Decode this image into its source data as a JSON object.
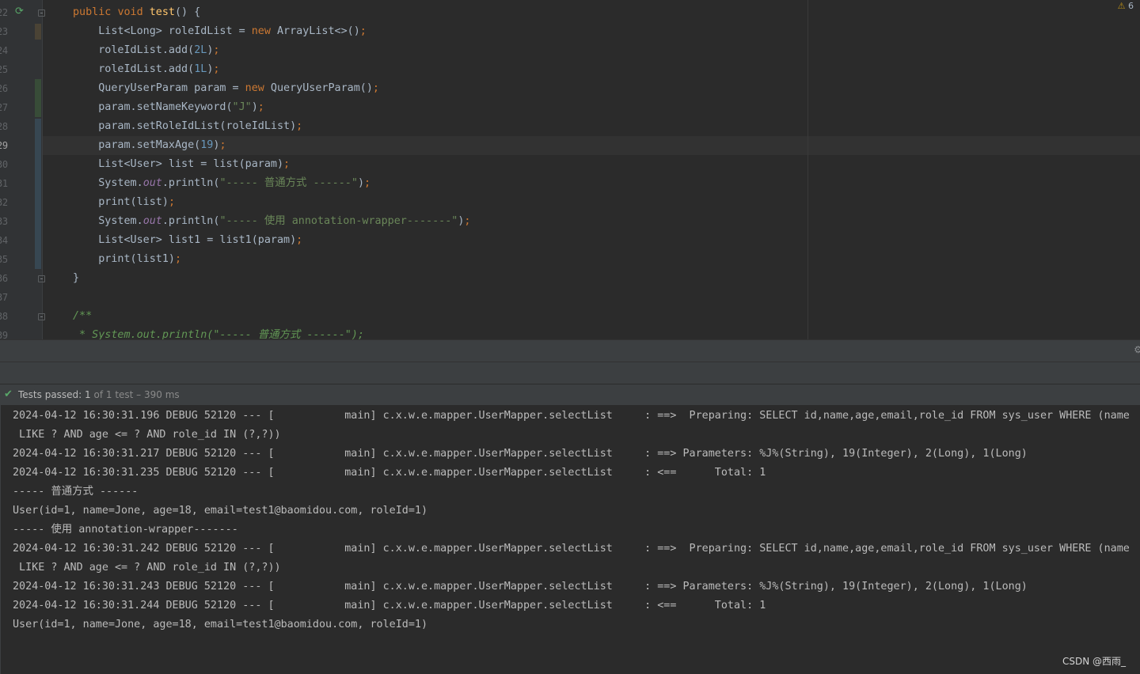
{
  "editor": {
    "line_numbers": [
      "22",
      "23",
      "24",
      "25",
      "26",
      "27",
      "28",
      "29",
      "30",
      "31",
      "32",
      "33",
      "34",
      "35",
      "36",
      "37",
      "38",
      "39"
    ],
    "current_line": "29",
    "warning_count": "6",
    "code_lines": [
      [
        {
          "t": "public ",
          "c": "kw"
        },
        {
          "t": "void ",
          "c": "kw"
        },
        {
          "t": "test",
          "c": "fn"
        },
        {
          "t": "() {",
          "c": ""
        }
      ],
      [
        {
          "t": "    List<Long> roleIdList = ",
          "c": ""
        },
        {
          "t": "new ",
          "c": "kw"
        },
        {
          "t": "ArrayList<>()",
          "c": ""
        },
        {
          "t": ";",
          "c": "kw"
        }
      ],
      [
        {
          "t": "    roleIdList.add(",
          "c": ""
        },
        {
          "t": "2L",
          "c": "num"
        },
        {
          "t": ")",
          "c": ""
        },
        {
          "t": ";",
          "c": "kw"
        }
      ],
      [
        {
          "t": "    roleIdList.add(",
          "c": ""
        },
        {
          "t": "1L",
          "c": "num"
        },
        {
          "t": ")",
          "c": ""
        },
        {
          "t": ";",
          "c": "kw"
        }
      ],
      [
        {
          "t": "    QueryUserParam param = ",
          "c": ""
        },
        {
          "t": "new ",
          "c": "kw"
        },
        {
          "t": "QueryUserParam()",
          "c": ""
        },
        {
          "t": ";",
          "c": "kw"
        }
      ],
      [
        {
          "t": "    param.setNameKeyword(",
          "c": ""
        },
        {
          "t": "\"J\"",
          "c": "str"
        },
        {
          "t": ")",
          "c": ""
        },
        {
          "t": ";",
          "c": "kw"
        }
      ],
      [
        {
          "t": "    param.setRoleIdList(roleIdList)",
          "c": ""
        },
        {
          "t": ";",
          "c": "kw"
        }
      ],
      [
        {
          "t": "    param.setMaxAge(",
          "c": ""
        },
        {
          "t": "19",
          "c": "num"
        },
        {
          "t": ")",
          "c": ""
        },
        {
          "t": ";",
          "c": "kw"
        }
      ],
      [
        {
          "t": "    List<User> list = list(param)",
          "c": ""
        },
        {
          "t": ";",
          "c": "kw"
        }
      ],
      [
        {
          "t": "    System.",
          "c": ""
        },
        {
          "t": "out",
          "c": "field"
        },
        {
          "t": ".println(",
          "c": ""
        },
        {
          "t": "\"----- 普通方式 ------\"",
          "c": "str"
        },
        {
          "t": ")",
          "c": ""
        },
        {
          "t": ";",
          "c": "kw"
        }
      ],
      [
        {
          "t": "    print(list)",
          "c": ""
        },
        {
          "t": ";",
          "c": "kw"
        }
      ],
      [
        {
          "t": "    System.",
          "c": ""
        },
        {
          "t": "out",
          "c": "field"
        },
        {
          "t": ".println(",
          "c": ""
        },
        {
          "t": "\"----- 使用 annotation-wrapper-------\"",
          "c": "str"
        },
        {
          "t": ")",
          "c": ""
        },
        {
          "t": ";",
          "c": "kw"
        }
      ],
      [
        {
          "t": "    List<User> list1 = list1(param)",
          "c": ""
        },
        {
          "t": ";",
          "c": "kw"
        }
      ],
      [
        {
          "t": "    print(list1)",
          "c": ""
        },
        {
          "t": ";",
          "c": "kw"
        }
      ],
      [
        {
          "t": "}",
          "c": ""
        }
      ],
      [
        {
          "t": "",
          "c": ""
        }
      ],
      [
        {
          "t": "/**",
          "c": "cmt"
        }
      ],
      [
        {
          "t": " * System.out.println(\"----- 普通方式 ------\");",
          "c": "cmt"
        }
      ]
    ]
  },
  "test_status": {
    "label": "Tests passed: ",
    "passed": "1",
    "suffix": " of 1 test – 390 ms"
  },
  "console_lines": [
    "2024-04-12 16:30:31.196 DEBUG 52120 --- [           main] c.x.w.e.mapper.UserMapper.selectList     : ==>  Preparing: SELECT id,name,age,email,role_id FROM sys_user WHERE (name",
    " LIKE ? AND age <= ? AND role_id IN (?,?))",
    "2024-04-12 16:30:31.217 DEBUG 52120 --- [           main] c.x.w.e.mapper.UserMapper.selectList     : ==> Parameters: %J%(String), 19(Integer), 2(Long), 1(Long)",
    "2024-04-12 16:30:31.235 DEBUG 52120 --- [           main] c.x.w.e.mapper.UserMapper.selectList     : <==      Total: 1",
    "----- 普通方式 ------",
    "User(id=1, name=Jone, age=18, email=test1@baomidou.com, roleId=1)",
    "----- 使用 annotation-wrapper-------",
    "2024-04-12 16:30:31.242 DEBUG 52120 --- [           main] c.x.w.e.mapper.UserMapper.selectList     : ==>  Preparing: SELECT id,name,age,email,role_id FROM sys_user WHERE (name",
    " LIKE ? AND age <= ? AND role_id IN (?,?))",
    "2024-04-12 16:30:31.243 DEBUG 52120 --- [           main] c.x.w.e.mapper.UserMapper.selectList     : ==> Parameters: %J%(String), 19(Integer), 2(Long), 1(Long)",
    "2024-04-12 16:30:31.244 DEBUG 52120 --- [           main] c.x.w.e.mapper.UserMapper.selectList     : <==      Total: 1",
    "User(id=1, name=Jone, age=18, email=test1@baomidou.com, roleId=1)"
  ],
  "watermark": "CSDN @西雨_",
  "colors": {
    "editor_bg": "#2b2b2b",
    "keyword": "#cc7832",
    "function": "#ffc66d",
    "number": "#6897bb",
    "string": "#6a8759",
    "pass_green": "#59a869"
  }
}
